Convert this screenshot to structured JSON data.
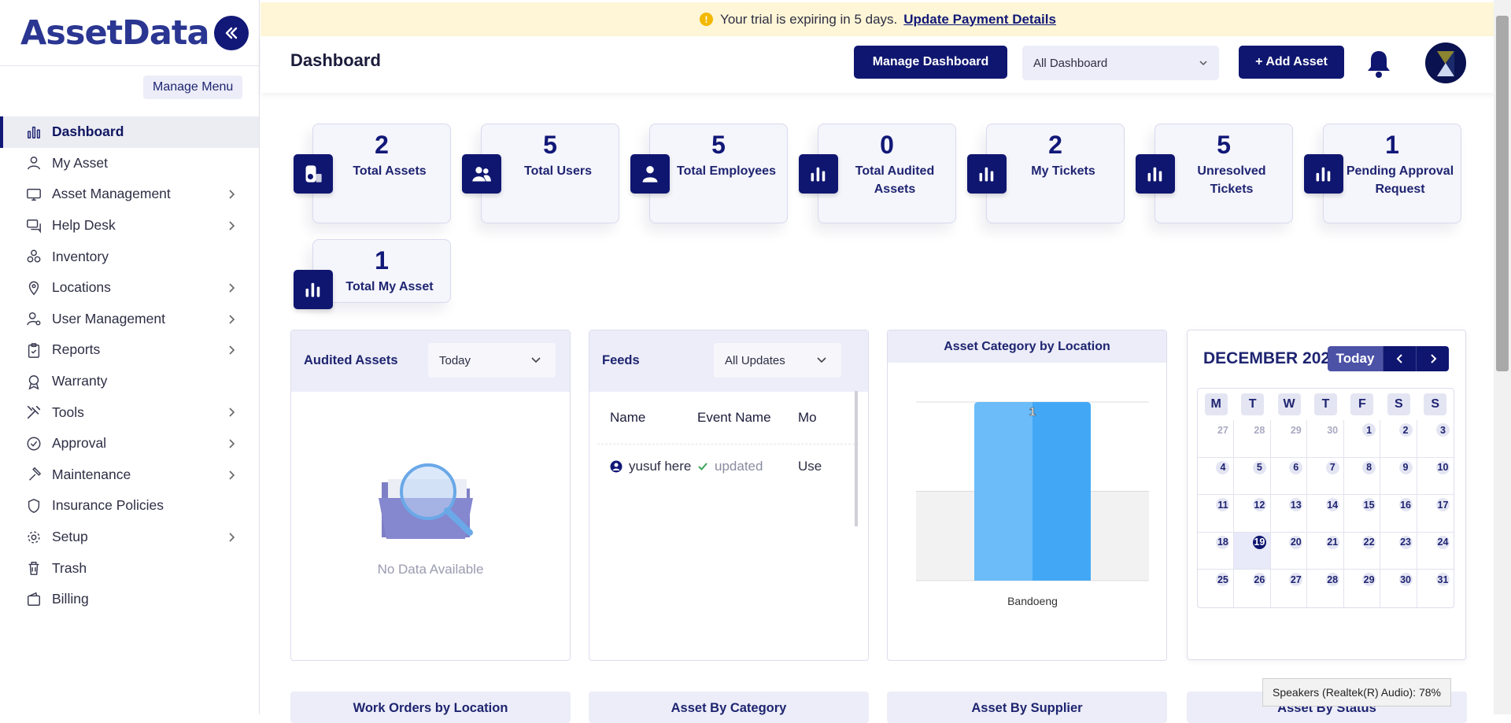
{
  "sidebar": {
    "logo": "AssetData",
    "manage_menu": "Manage Menu",
    "items": [
      {
        "label": "Dashboard",
        "icon": "bar-chart-icon",
        "active": true,
        "has_submenu": false
      },
      {
        "label": "My Asset",
        "icon": "user-icon",
        "has_submenu": false
      },
      {
        "label": "Asset Management",
        "icon": "monitor-icon",
        "has_submenu": true
      },
      {
        "label": "Help Desk",
        "icon": "chat-icon",
        "has_submenu": true
      },
      {
        "label": "Inventory",
        "icon": "boxes-icon",
        "has_submenu": false
      },
      {
        "label": "Locations",
        "icon": "map-pin-icon",
        "has_submenu": true
      },
      {
        "label": "User Management",
        "icon": "user-gear-icon",
        "has_submenu": true
      },
      {
        "label": "Reports",
        "icon": "clipboard-icon",
        "has_submenu": true
      },
      {
        "label": "Warranty",
        "icon": "award-icon",
        "has_submenu": false
      },
      {
        "label": "Tools",
        "icon": "tools-icon",
        "has_submenu": true
      },
      {
        "label": "Approval",
        "icon": "check-circle-icon",
        "has_submenu": true
      },
      {
        "label": "Maintenance",
        "icon": "hammer-icon",
        "has_submenu": true
      },
      {
        "label": "Insurance Policies",
        "icon": "shield-icon",
        "has_submenu": false
      },
      {
        "label": "Setup",
        "icon": "gear-icon",
        "has_submenu": true
      },
      {
        "label": "Trash",
        "icon": "trash-icon",
        "has_submenu": false
      },
      {
        "label": "Billing",
        "icon": "wallet-icon",
        "has_submenu": false
      }
    ]
  },
  "trial_banner": {
    "message": "Your trial is expiring in 5 days.",
    "link": "Update Payment Details"
  },
  "header": {
    "title": "Dashboard",
    "manage_dashboard": "Manage Dashboard",
    "dashboard_select": "All Dashboard",
    "add_asset": "+ Add Asset"
  },
  "stats": [
    {
      "value": "2",
      "label": "Total Assets",
      "icon": "asset-icon"
    },
    {
      "value": "5",
      "label": "Total Users",
      "icon": "users-icon"
    },
    {
      "value": "5",
      "label": "Total Employees",
      "icon": "employee-icon"
    },
    {
      "value": "0",
      "label": "Total Audited Assets",
      "icon": "bar-chart-icon"
    },
    {
      "value": "2",
      "label": "My Tickets",
      "icon": "bar-chart-icon"
    },
    {
      "value": "5",
      "label": "Unresolved Tickets",
      "icon": "bar-chart-icon"
    },
    {
      "value": "1",
      "label": "Pending Approval Request",
      "icon": "bar-chart-icon"
    },
    {
      "value": "1",
      "label": "Total My Asset",
      "icon": "bar-chart-icon"
    }
  ],
  "audited_assets": {
    "title": "Audited Assets",
    "filter": "Today",
    "empty": "No Data Available"
  },
  "feeds": {
    "title": "Feeds",
    "filter": "All Updates",
    "columns": [
      "Name",
      "Event Name",
      "Mo"
    ],
    "rows": [
      {
        "name": "yusuf here",
        "event": "updated",
        "module": "Use"
      }
    ]
  },
  "asset_category_chart": {
    "title": "Asset Category by Location"
  },
  "chart_data": {
    "type": "bar",
    "title": "Asset Category by Location",
    "categories": [
      "Bandoeng"
    ],
    "values": [
      1
    ],
    "data_labels": [
      "1"
    ],
    "ylim": [
      0,
      1
    ],
    "grid": true,
    "colors": [
      "#6bbcf8",
      "#42a8f6"
    ]
  },
  "calendar": {
    "month_label": "DECEMBER 2023",
    "today_label": "Today",
    "weekdays": [
      "M",
      "T",
      "W",
      "T",
      "F",
      "S",
      "S"
    ],
    "weeks": [
      [
        "27",
        "28",
        "29",
        "30",
        "1",
        "2",
        "3"
      ],
      [
        "4",
        "5",
        "6",
        "7",
        "8",
        "9",
        "10"
      ],
      [
        "11",
        "12",
        "13",
        "14",
        "15",
        "16",
        "17"
      ],
      [
        "18",
        "19",
        "20",
        "21",
        "22",
        "23",
        "24"
      ],
      [
        "25",
        "26",
        "27",
        "28",
        "29",
        "30",
        "31"
      ]
    ],
    "today": "19"
  },
  "bottom_panels": [
    "Work Orders by Location",
    "Asset By Category",
    "Asset By Supplier",
    "Asset By Status"
  ],
  "tooltip": "Speakers (Realtek(R) Audio): 78%",
  "colors": {
    "primary": "#0f1670",
    "banner": "#fef6d6",
    "panel_header": "#ecedf8",
    "bar_light": "#6bbcf8",
    "bar_dark": "#42a8f6"
  }
}
